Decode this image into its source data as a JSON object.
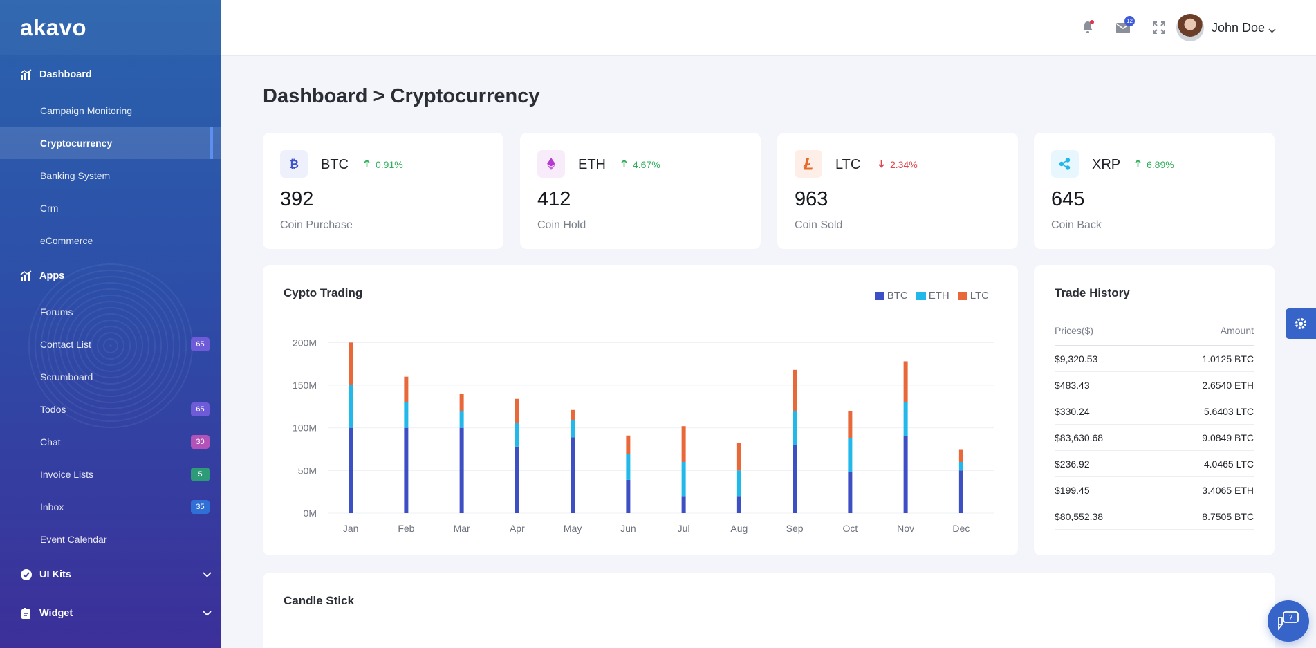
{
  "brand": {
    "name": "akavo"
  },
  "sidebar": {
    "sections": [
      {
        "label": "Dashboard",
        "icon": "chart-icon",
        "items": [
          {
            "label": "Campaign Monitoring"
          },
          {
            "label": "Cryptocurrency",
            "active": true
          },
          {
            "label": "Banking System"
          },
          {
            "label": "Crm"
          },
          {
            "label": "eCommerce"
          }
        ]
      },
      {
        "label": "Apps",
        "icon": "chart-icon",
        "items": [
          {
            "label": "Forums"
          },
          {
            "label": "Contact List",
            "badge": "65",
            "badge_color": "#6d5bd8"
          },
          {
            "label": "Scrumboard"
          },
          {
            "label": "Todos",
            "badge": "65",
            "badge_color": "#6d5bd8"
          },
          {
            "label": "Chat",
            "badge": "30",
            "badge_color": "#b153b8"
          },
          {
            "label": "Invoice Lists",
            "badge": "5",
            "badge_color": "#2e9b78"
          },
          {
            "label": "Inbox",
            "badge": "35",
            "badge_color": "#2f6fd6"
          },
          {
            "label": "Event Calendar"
          }
        ]
      },
      {
        "label": "UI Kits",
        "icon": "check-circle-icon",
        "collapsed": true
      },
      {
        "label": "Widget",
        "icon": "widget-icon",
        "collapsed": true
      }
    ]
  },
  "header": {
    "mail_count": "12",
    "user_name": "John Doe"
  },
  "page": {
    "title": "Dashboard > Cryptocurrency"
  },
  "stats": [
    {
      "symbol": "BTC",
      "change": "0.91%",
      "direction": "up",
      "value": "392",
      "label": "Coin Purchase",
      "color": "#3d55c9",
      "bg": "#eef0fb",
      "icon": "bitcoin-icon"
    },
    {
      "symbol": "ETH",
      "change": "4.67%",
      "direction": "up",
      "value": "412",
      "label": "Coin Hold",
      "color": "#b43ad1",
      "bg": "#f8ecfb",
      "icon": "ethereum-icon"
    },
    {
      "symbol": "LTC",
      "change": "2.34%",
      "direction": "down",
      "value": "963",
      "label": "Coin Sold",
      "color": "#e76a2b",
      "bg": "#fdefe7",
      "icon": "litecoin-icon"
    },
    {
      "symbol": "XRP",
      "change": "6.89%",
      "direction": "up",
      "value": "645",
      "label": "Coin Back",
      "color": "#21b7ea",
      "bg": "#e7f7fd",
      "icon": "ripple-icon"
    }
  ],
  "chart_card": {
    "title": "Cypto Trading"
  },
  "chart_data": {
    "type": "bar",
    "stacked": true,
    "categories": [
      "Jan",
      "Feb",
      "Mar",
      "Apr",
      "May",
      "Jun",
      "Jul",
      "Aug",
      "Sep",
      "Oct",
      "Nov",
      "Dec"
    ],
    "series": [
      {
        "name": "BTC",
        "color": "#3d4fc4",
        "values": [
          100,
          100,
          100,
          78,
          89,
          39,
          20,
          20,
          80,
          48,
          90,
          50
        ]
      },
      {
        "name": "ETH",
        "color": "#22b8ea",
        "values": [
          50,
          30,
          20,
          28,
          20,
          30,
          40,
          30,
          40,
          40,
          40,
          10
        ]
      },
      {
        "name": "LTC",
        "color": "#e8683a",
        "values": [
          50,
          30,
          20,
          28,
          12,
          22,
          42,
          32,
          48,
          32,
          48,
          15
        ]
      }
    ],
    "yticks": [
      "0M",
      "50M",
      "100M",
      "150M",
      "200M"
    ],
    "ylim": [
      0,
      200
    ],
    "legend": "top-right",
    "grid": true
  },
  "trade_history": {
    "title": "Trade History",
    "columns": [
      "Prices($)",
      "Amount"
    ],
    "rows": [
      {
        "price": "$9,320.53",
        "amount": "1.0125 BTC"
      },
      {
        "price": "$483.43",
        "amount": "2.6540 ETH"
      },
      {
        "price": "$330.24",
        "amount": "5.6403 LTC"
      },
      {
        "price": "$83,630.68",
        "amount": "9.0849 BTC"
      },
      {
        "price": "$236.92",
        "amount": "4.0465 LTC"
      },
      {
        "price": "$199.45",
        "amount": "3.4065 ETH"
      },
      {
        "price": "$80,552.38",
        "amount": "8.7505 BTC"
      }
    ]
  },
  "candle_card": {
    "title": "Candle Stick"
  }
}
